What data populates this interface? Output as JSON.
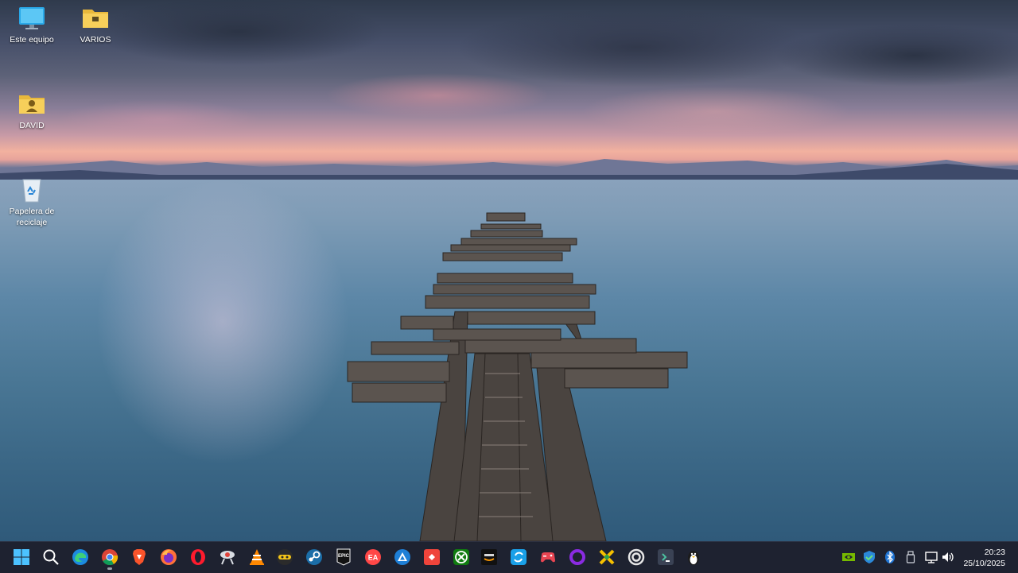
{
  "desktop_icons": [
    {
      "name": "this-pc",
      "label": "Este equipo"
    },
    {
      "name": "folder-varios",
      "label": "VARIOS"
    },
    {
      "name": "user-folder-david",
      "label": "DAVID"
    },
    {
      "name": "recycle-bin",
      "label": "Papelera de reciclaje"
    }
  ],
  "taskbar": {
    "apps": [
      {
        "name": "start",
        "icon": "windows-logo-icon"
      },
      {
        "name": "search",
        "icon": "search-icon"
      },
      {
        "name": "edge",
        "icon": "edge-icon"
      },
      {
        "name": "chrome",
        "icon": "chrome-icon"
      },
      {
        "name": "brave",
        "icon": "brave-icon"
      },
      {
        "name": "firefox",
        "icon": "firefox-icon"
      },
      {
        "name": "opera",
        "icon": "opera-icon"
      },
      {
        "name": "satellite-app",
        "icon": "satellite-icon"
      },
      {
        "name": "vlc",
        "icon": "vlc-icon"
      },
      {
        "name": "game-launcher",
        "icon": "gamepad-icon"
      },
      {
        "name": "steam",
        "icon": "steam-icon"
      },
      {
        "name": "epic-games",
        "icon": "epic-games-icon"
      },
      {
        "name": "ea-app",
        "icon": "ea-icon"
      },
      {
        "name": "triangle-app",
        "icon": "triangle-icon"
      },
      {
        "name": "anydesk",
        "icon": "anydesk-icon"
      },
      {
        "name": "xbox",
        "icon": "xbox-icon"
      },
      {
        "name": "amazon-games",
        "icon": "amazon-games-icon"
      },
      {
        "name": "sync-app",
        "icon": "sync-icon"
      },
      {
        "name": "controller-app",
        "icon": "controller-icon"
      },
      {
        "name": "ring-app",
        "icon": "ring-icon"
      },
      {
        "name": "emulator-app",
        "icon": "emulator-icon"
      },
      {
        "name": "circle-app",
        "icon": "circle-icon"
      },
      {
        "name": "code-app",
        "icon": "code-icon"
      },
      {
        "name": "qq",
        "icon": "penguin-icon"
      }
    ],
    "tray": [
      {
        "name": "nvidia",
        "icon": "nvidia-icon"
      },
      {
        "name": "security",
        "icon": "shield-icon"
      },
      {
        "name": "bluetooth",
        "icon": "bluetooth-icon"
      },
      {
        "name": "usb",
        "icon": "usb-icon"
      },
      {
        "name": "network",
        "icon": "monitor-network-icon"
      },
      {
        "name": "volume",
        "icon": "volume-icon"
      }
    ],
    "clock": {
      "time": "20:23",
      "date": "25/10/2025"
    }
  }
}
